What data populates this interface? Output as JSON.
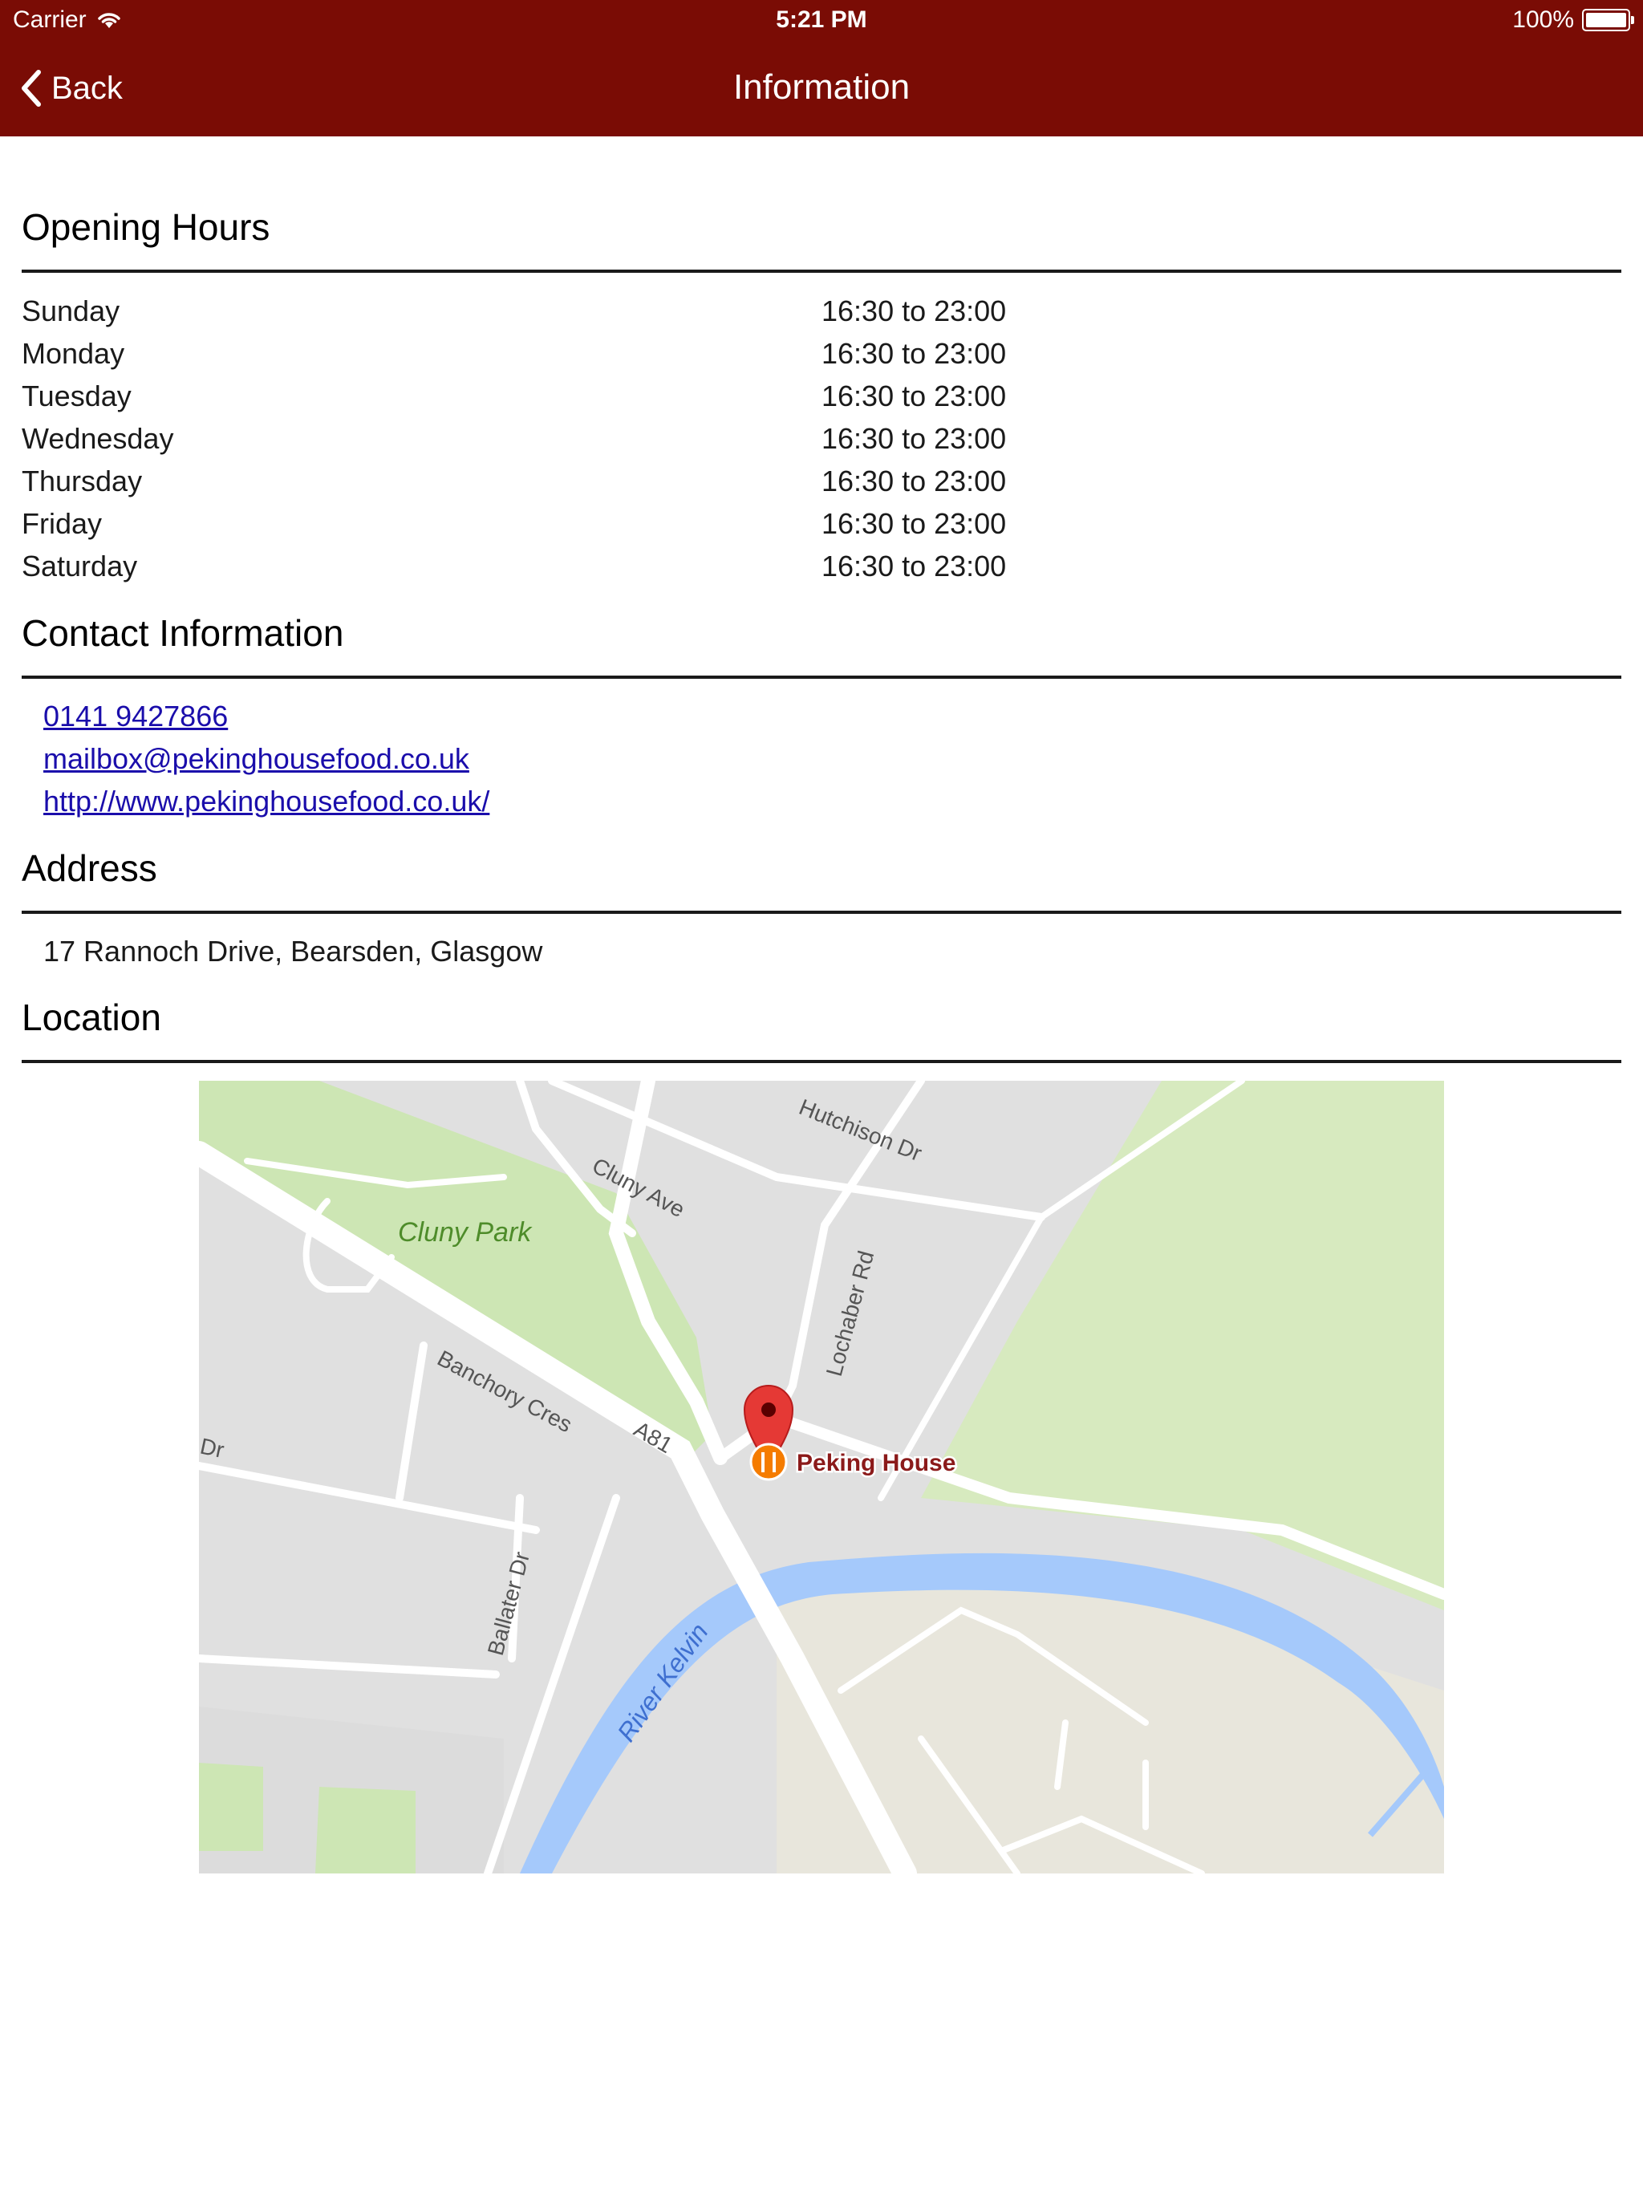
{
  "status_bar": {
    "carrier": "Carrier",
    "time": "5:21 PM",
    "battery": "100%"
  },
  "nav": {
    "back_label": "Back",
    "title": "Information"
  },
  "opening_hours": {
    "title": "Opening Hours",
    "rows": [
      {
        "day": "Sunday",
        "hours": "16:30 to 23:00"
      },
      {
        "day": "Monday",
        "hours": "16:30 to 23:00"
      },
      {
        "day": "Tuesday",
        "hours": "16:30 to 23:00"
      },
      {
        "day": "Wednesday",
        "hours": "16:30 to 23:00"
      },
      {
        "day": "Thursday",
        "hours": "16:30 to 23:00"
      },
      {
        "day": "Friday",
        "hours": "16:30 to 23:00"
      },
      {
        "day": "Saturday",
        "hours": "16:30 to 23:00"
      }
    ]
  },
  "contact": {
    "title": "Contact Information",
    "phone": "0141 9427866",
    "email": "mailbox@pekinghousefood.co.uk",
    "website": "http://www.pekinghousefood.co.uk/"
  },
  "address": {
    "title": "Address",
    "text": "17 Rannoch Drive, Bearsden, Glasgow"
  },
  "location": {
    "title": "Location",
    "map_labels": {
      "park": "Cluny Park",
      "cluny_ave": "Cluny Ave",
      "hutchison": "Hutchison Dr",
      "lochaber": "Lochaber Rd",
      "banchory": "Banchory Cres",
      "a81": "A81",
      "dr": "Dr",
      "ballater": "Ballater Dr",
      "river": "River Kelvin",
      "place": "Peking House"
    }
  },
  "colors": {
    "nav_bg": "#7a0c05",
    "link": "#1a0dab",
    "map_bg": "#e0e0e0",
    "map_park": "#cde6b4",
    "map_water": "#a5c9fb",
    "pin": "#e53935"
  }
}
